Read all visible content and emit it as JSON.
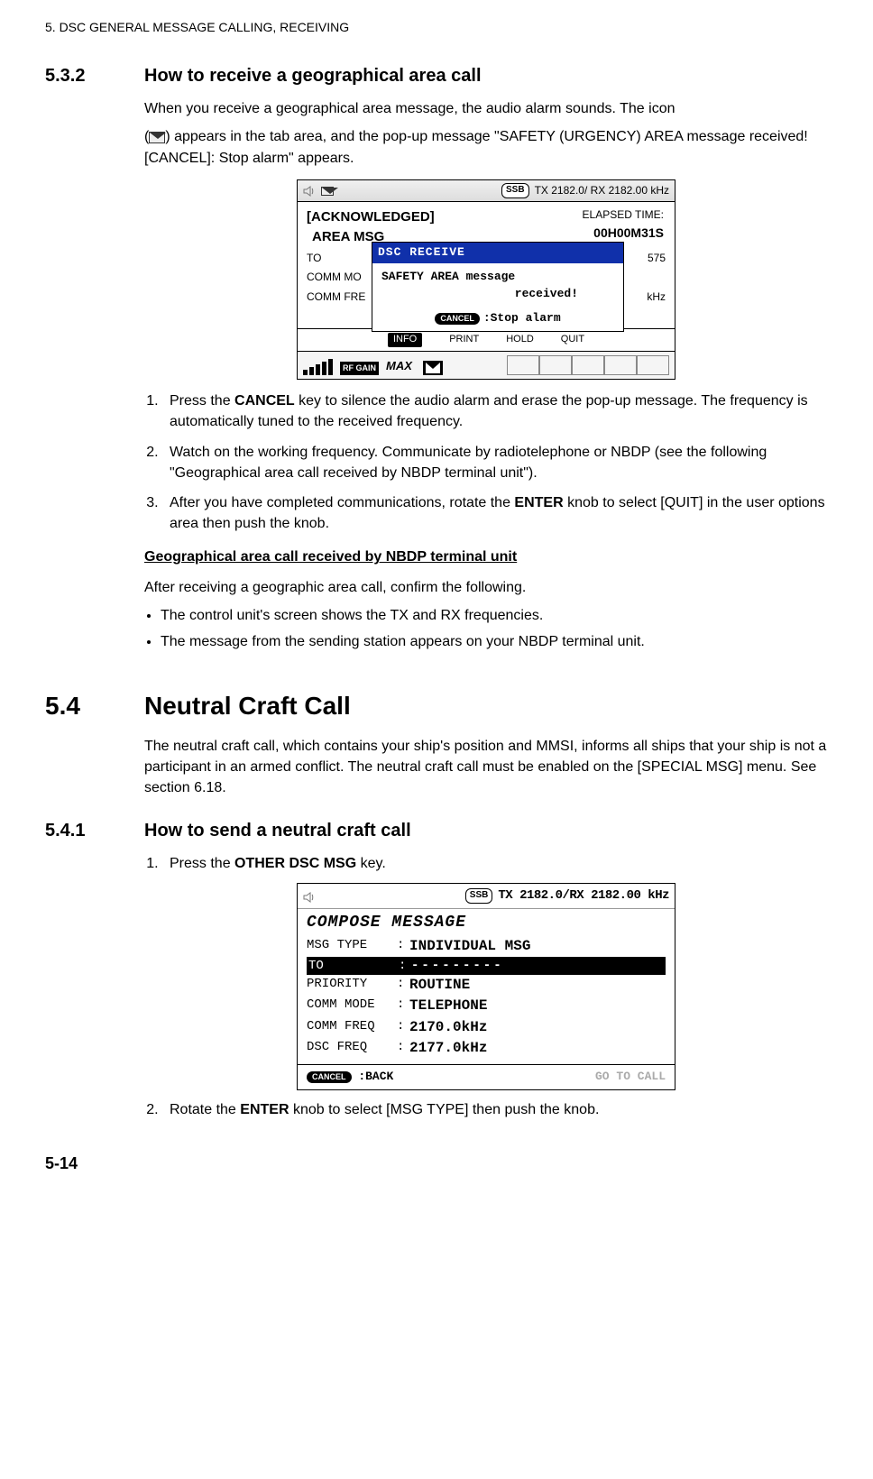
{
  "header": "5.  DSC GENERAL MESSAGE CALLING, RECEIVING",
  "s532": {
    "num": "5.3.2",
    "title": "How to receive a geographical area call",
    "p1a": "When you receive a geographical area message, the audio alarm sounds. The icon",
    "p1b": "(",
    "p1c": ") appears in the tab area, and the pop-up message \"SAFETY (URGENCY) AREA message received! [CANCEL]: Stop alarm\" appears."
  },
  "ss1": {
    "ssb": "SSB",
    "tx": "TX   2182.0/ RX   2182.00  kHz",
    "ack": "[ACKNOWLEDGED]",
    "area": "AREA MSG",
    "elapsed": "ELAPSED TIME:",
    "time": "00H00M31S",
    "to": "TO",
    "to_val": "575",
    "cm": "COMM MO",
    "cf": "COMM FRE",
    "cf_val": "kHz",
    "popup_title": "DSC RECEIVE",
    "popup_l1": "SAFETY AREA message",
    "popup_l2": "received!",
    "popup_cancel": "CANCEL",
    "popup_stop": ":Stop alarm",
    "tab_info": "INFO",
    "tab_print": "PRINT",
    "tab_hold": "HOLD",
    "tab_quit": "QUIT",
    "rfgain": "RF GAIN",
    "max": "MAX"
  },
  "steps1": {
    "s1a": "Press the ",
    "s1b": "CANCEL",
    "s1c": " key to silence the audio alarm and erase the pop-up message. The frequency is automatically tuned to the received frequency.",
    "s2": "Watch on the working frequency. Communicate by radiotelephone or NBDP (see the following \"Geographical area call received by NBDP terminal unit\").",
    "s3a": "After you have completed communications, rotate the ",
    "s3b": "ENTER",
    "s3c": " knob to select [QUIT] in the user options area then push the knob."
  },
  "nbdp": {
    "heading": "Geographical area call received by NBDP terminal unit",
    "intro": "After receiving a geographic area call, confirm the following.",
    "b1": "The control unit's screen shows the TX and RX frequencies.",
    "b2": "The message from the sending station appears on your NBDP terminal unit."
  },
  "s54": {
    "num": "5.4",
    "title": "Neutral Craft Call",
    "p1": "The neutral craft call, which contains your ship's position and MMSI, informs all ships that your ship is not a participant in an armed conflict. The neutral craft call must be enabled on the [SPECIAL MSG] menu. See section 6.18."
  },
  "s541": {
    "num": "5.4.1",
    "title": "How to send a neutral craft call",
    "s1a": "Press the ",
    "s1b": "OTHER DSC MSG",
    "s1c": " key.",
    "s2a": "Rotate the ",
    "s2b": "ENTER",
    "s2c": " knob to select [MSG TYPE] then push the knob."
  },
  "ss2": {
    "ssb": "SSB",
    "hdr": "TX 2182.0/RX 2182.00 kHz",
    "compose": "COMPOSE MESSAGE",
    "msgtype_l": "MSG TYPE",
    "msgtype_v": "INDIVIDUAL MSG",
    "to_l": "TO",
    "to_v": "---------",
    "pri_l": "PRIORITY",
    "pri_v": "ROUTINE",
    "cm_l": "COMM MODE",
    "cm_v": "TELEPHONE",
    "cf_l": "COMM FREQ",
    "cf_v": "2170.0kHz",
    "df_l": "DSC FREQ",
    "df_v": "2177.0kHz",
    "cancel": "CANCEL",
    "back": ":BACK",
    "go": "GO TO CALL"
  },
  "pagenum": "5-14"
}
